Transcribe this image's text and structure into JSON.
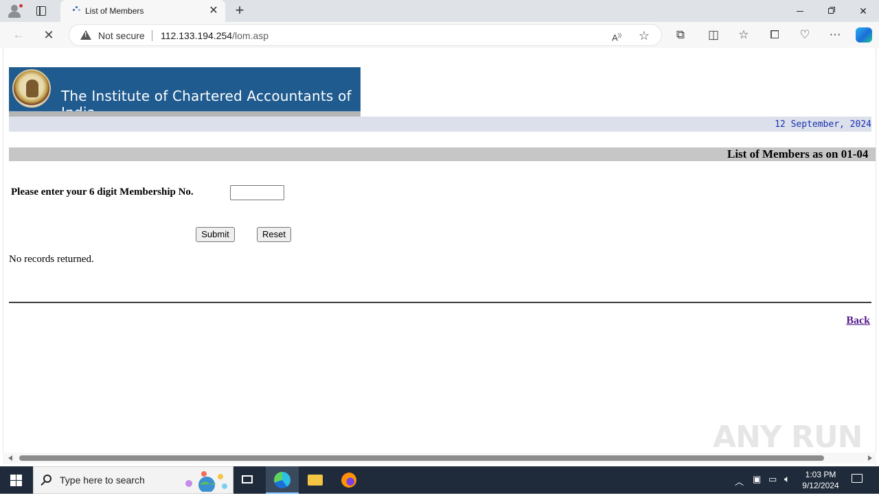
{
  "browser": {
    "tab_title": "List of Members",
    "new_tab_symbol": "+",
    "close_tab_symbol": "✕",
    "security_label": "Not secure",
    "url_host": "112.133.194.254",
    "url_path": "/lom.asp"
  },
  "page": {
    "banner_title": "The Institute of Chartered Accountants of India",
    "date": "12 September, 2024",
    "heading": "List of Members as on 01-04",
    "prompt_label": "Please enter your 6 digit Membership No.",
    "membership_input_value": "",
    "submit_label": "Submit",
    "reset_label": "Reset",
    "result_text": "No records returned.",
    "back_link": "Back"
  },
  "watermark": "ANY RUN",
  "taskbar": {
    "search_placeholder": "Type here to search",
    "time": "1:03 PM",
    "date": "9/12/2024"
  },
  "colors": {
    "banner_blue": "#1f5b8f",
    "date_text": "#1a2fb0",
    "visited_link": "#551a8b"
  }
}
